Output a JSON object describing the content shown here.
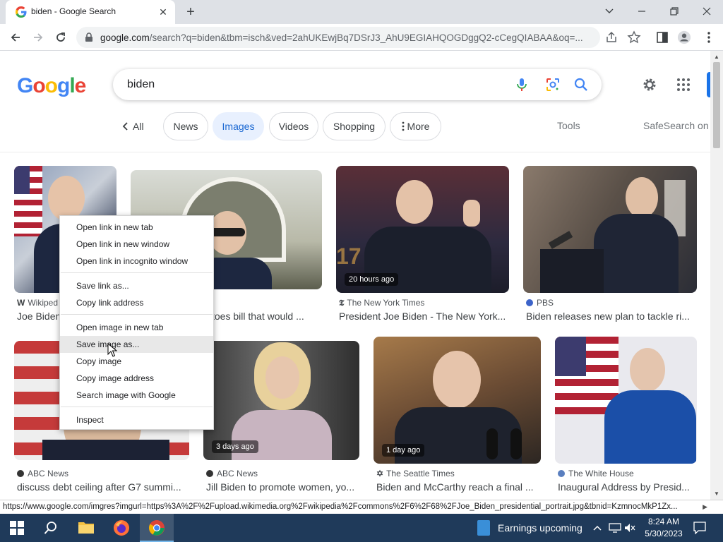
{
  "tab": {
    "title": "biden - Google Search",
    "close": "✕",
    "new_tab": "+"
  },
  "toolbar": {
    "url_host": "google.com",
    "url_rest": "/search?q=biden&tbm=isch&ved=2ahUKEwjBq7DSrJ3_AhU9EGIAHQOGDggQ2-cCegQIABAA&oq=..."
  },
  "google": {
    "logo_letters": [
      {
        "ch": "G",
        "color": "#4285f4"
      },
      {
        "ch": "o",
        "color": "#ea4335"
      },
      {
        "ch": "o",
        "color": "#fbbc05"
      },
      {
        "ch": "g",
        "color": "#4285f4"
      },
      {
        "ch": "l",
        "color": "#34a853"
      },
      {
        "ch": "e",
        "color": "#ea4335"
      }
    ],
    "query": "biden"
  },
  "chips": {
    "all": "All",
    "items": [
      "News",
      "Images",
      "Videos",
      "Shopping",
      "More"
    ],
    "active": "Images",
    "tools": "Tools",
    "safesearch": "SafeSearch on"
  },
  "results": [
    {
      "source": "Wikiped",
      "caption": "Joe Biden",
      "age": ""
    },
    {
      "source": "",
      "caption": "toes bill that would ...",
      "age": ""
    },
    {
      "source": "The New York Times",
      "caption": "President Joe Biden - The New York...",
      "age": "20 hours ago"
    },
    {
      "source": "PBS",
      "caption": "Biden releases new plan to tackle ri...",
      "age": ""
    },
    {
      "source": "ABC News",
      "caption": "discuss debt ceiling after G7 summi...",
      "age": ""
    },
    {
      "source": "ABC News",
      "caption": "Jill Biden to promote women, yo...",
      "age": "3 days ago"
    },
    {
      "source": "The Seattle Times",
      "caption": "Biden and McCarthy reach a final ...",
      "age": "1 day ago"
    },
    {
      "source": "The White House",
      "caption": "Inaugural Address by Presid...",
      "age": ""
    }
  ],
  "context_menu": {
    "items": [
      "Open link in new tab",
      "Open link in new window",
      "Open link in incognito window",
      "Save link as...",
      "Copy link address",
      "Open image in new tab",
      "Save image as...",
      "Copy image",
      "Copy image address",
      "Search image with Google",
      "Inspect"
    ],
    "highlighted": "Save image as..."
  },
  "status_url": "https://www.google.com/imgres?imgurl=https%3A%2F%2Fupload.wikimedia.org%2Fwikipedia%2Fcommons%2F6%2F68%2FJoe_Biden_presidential_portrait.jpg&tbnid=KzmnocMkP1Zx...",
  "taskbar": {
    "news": "Earnings upcoming",
    "time": "8:24 AM",
    "date": "5/30/2023"
  },
  "colors": {
    "accent": "#1a73e8",
    "active_chip_bg": "#e8f0fe",
    "taskbar": "#1f3a5a"
  }
}
